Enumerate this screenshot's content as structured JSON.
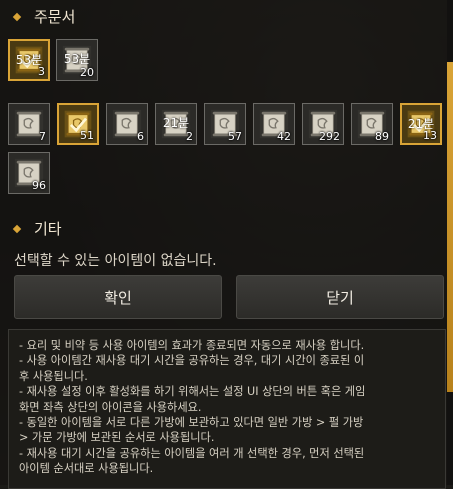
{
  "sections": {
    "scrolls": {
      "title": "주문서"
    },
    "misc": {
      "title": "기타"
    }
  },
  "scroll_slots": [
    {
      "label": "53분",
      "count": "3",
      "gold": true,
      "icon": "scroll-icon"
    },
    {
      "label": "53분",
      "count": "20",
      "gold": false,
      "icon": "scroll-icon"
    }
  ],
  "item_slots": [
    {
      "label": "",
      "count": "7",
      "gold": false,
      "icon": "scroll-icon"
    },
    {
      "label": "",
      "count": "51",
      "gold": true,
      "icon": "scroll-icon"
    },
    {
      "label": "",
      "count": "6",
      "gold": false,
      "icon": "scroll-icon"
    },
    {
      "label": "21분",
      "count": "2",
      "gold": false,
      "icon": "scroll-icon"
    },
    {
      "label": "",
      "count": "57",
      "gold": false,
      "icon": "scroll-icon"
    },
    {
      "label": "",
      "count": "42",
      "gold": false,
      "icon": "scroll-icon"
    },
    {
      "label": "",
      "count": "292",
      "gold": false,
      "icon": "scroll-icon"
    },
    {
      "label": "",
      "count": "89",
      "gold": false,
      "icon": "scroll-icon"
    },
    {
      "label": "21분",
      "count": "13",
      "gold": true,
      "icon": "scroll-icon"
    },
    {
      "label": "",
      "count": "96",
      "gold": false,
      "icon": "scroll-icon"
    }
  ],
  "message": "선택할 수 있는 아이템이 없습니다.",
  "buttons": {
    "confirm": "확인",
    "close": "닫기"
  },
  "info_lines": [
    "- 요리 및 비약 등 사용 아이템의 효과가 종료되면 자동으로 재사용 합니다.",
    "- 사용 아이템간 재사용 대기 시간을 공유하는 경우, 대기 시간이 종료된 이",
    "후 사용됩니다.",
    "- 재사용 설정 이후 활성화를 하기 위해서는 설정 UI 상단의 버튼 혹은 게임",
    "화면 좌측 상단의 아이콘을 사용하세요.",
    "- 동일한 아이템을 서로 다른 가방에 보관하고 있다면 일반 가방 > 펄 가방",
    "> 가문 가방에 보관된 순서로 사용됩니다.",
    "- 재사용 대기 시간을 공유하는 아이템을 여러 개 선택한 경우, 먼저 선택된",
    "아이템 순서대로 사용됩니다."
  ],
  "colors": {
    "accent": "#d9a437",
    "panel": "#1b1a17"
  }
}
